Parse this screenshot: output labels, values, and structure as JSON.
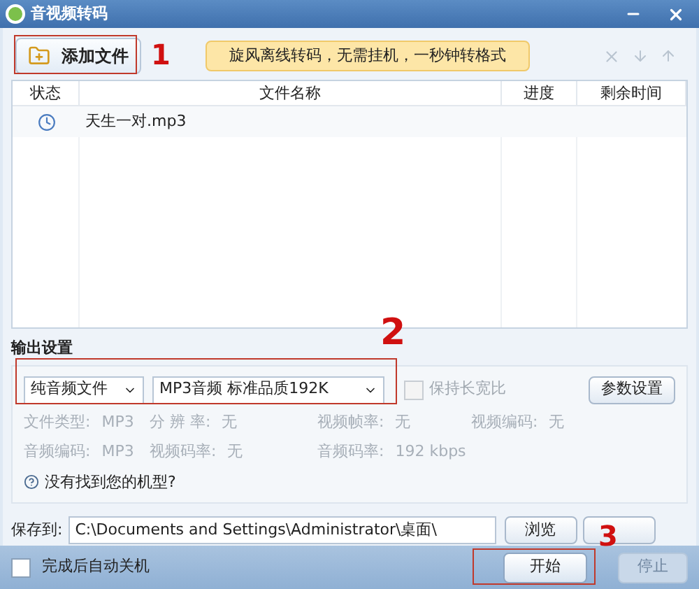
{
  "window": {
    "title": "音视频转码"
  },
  "toolbar": {
    "add_button": "添加文件",
    "banner": "旋风离线转码，无需挂机，一秒钟转格式"
  },
  "table": {
    "columns": [
      "状态",
      "文件名称",
      "进度",
      "剩余时间"
    ],
    "rows": [
      {
        "kind": "waiting",
        "name": "天生一对.mp3",
        "progress": "",
        "remaining": ""
      }
    ]
  },
  "output": {
    "heading": "输出设置",
    "category": "纯音频文件",
    "preset": "MP3音频 标准品质192K",
    "keep_ratio": {
      "label": "保持长宽比",
      "checked": false,
      "disabled": true
    },
    "params_button": "参数设置",
    "info": [
      [
        {
          "label": "文件类型:",
          "value": "MP3"
        },
        {
          "label": "分 辨 率:",
          "value": "无"
        },
        {
          "label": "视频帧率:",
          "value": "无"
        },
        {
          "label": "视频编码:",
          "value": "无"
        }
      ],
      [
        {
          "label": "音频编码:",
          "value": "MP3"
        },
        {
          "label": "视频码率:",
          "value": "无"
        },
        {
          "label": "音频码率:",
          "value": "192 kbps"
        }
      ]
    ],
    "help_link": "没有找到您的机型?"
  },
  "save": {
    "label": "保存到:",
    "path": "C:\\Documents and Settings\\Administrator\\桌面\\",
    "browse_button": "浏览"
  },
  "footer": {
    "auto_shutdown": {
      "label": "完成后自动关机",
      "checked": false
    },
    "start_button": "开始",
    "stop_button": {
      "label": "停止",
      "disabled": true
    }
  },
  "annotations": [
    "1",
    "2",
    "3"
  ]
}
